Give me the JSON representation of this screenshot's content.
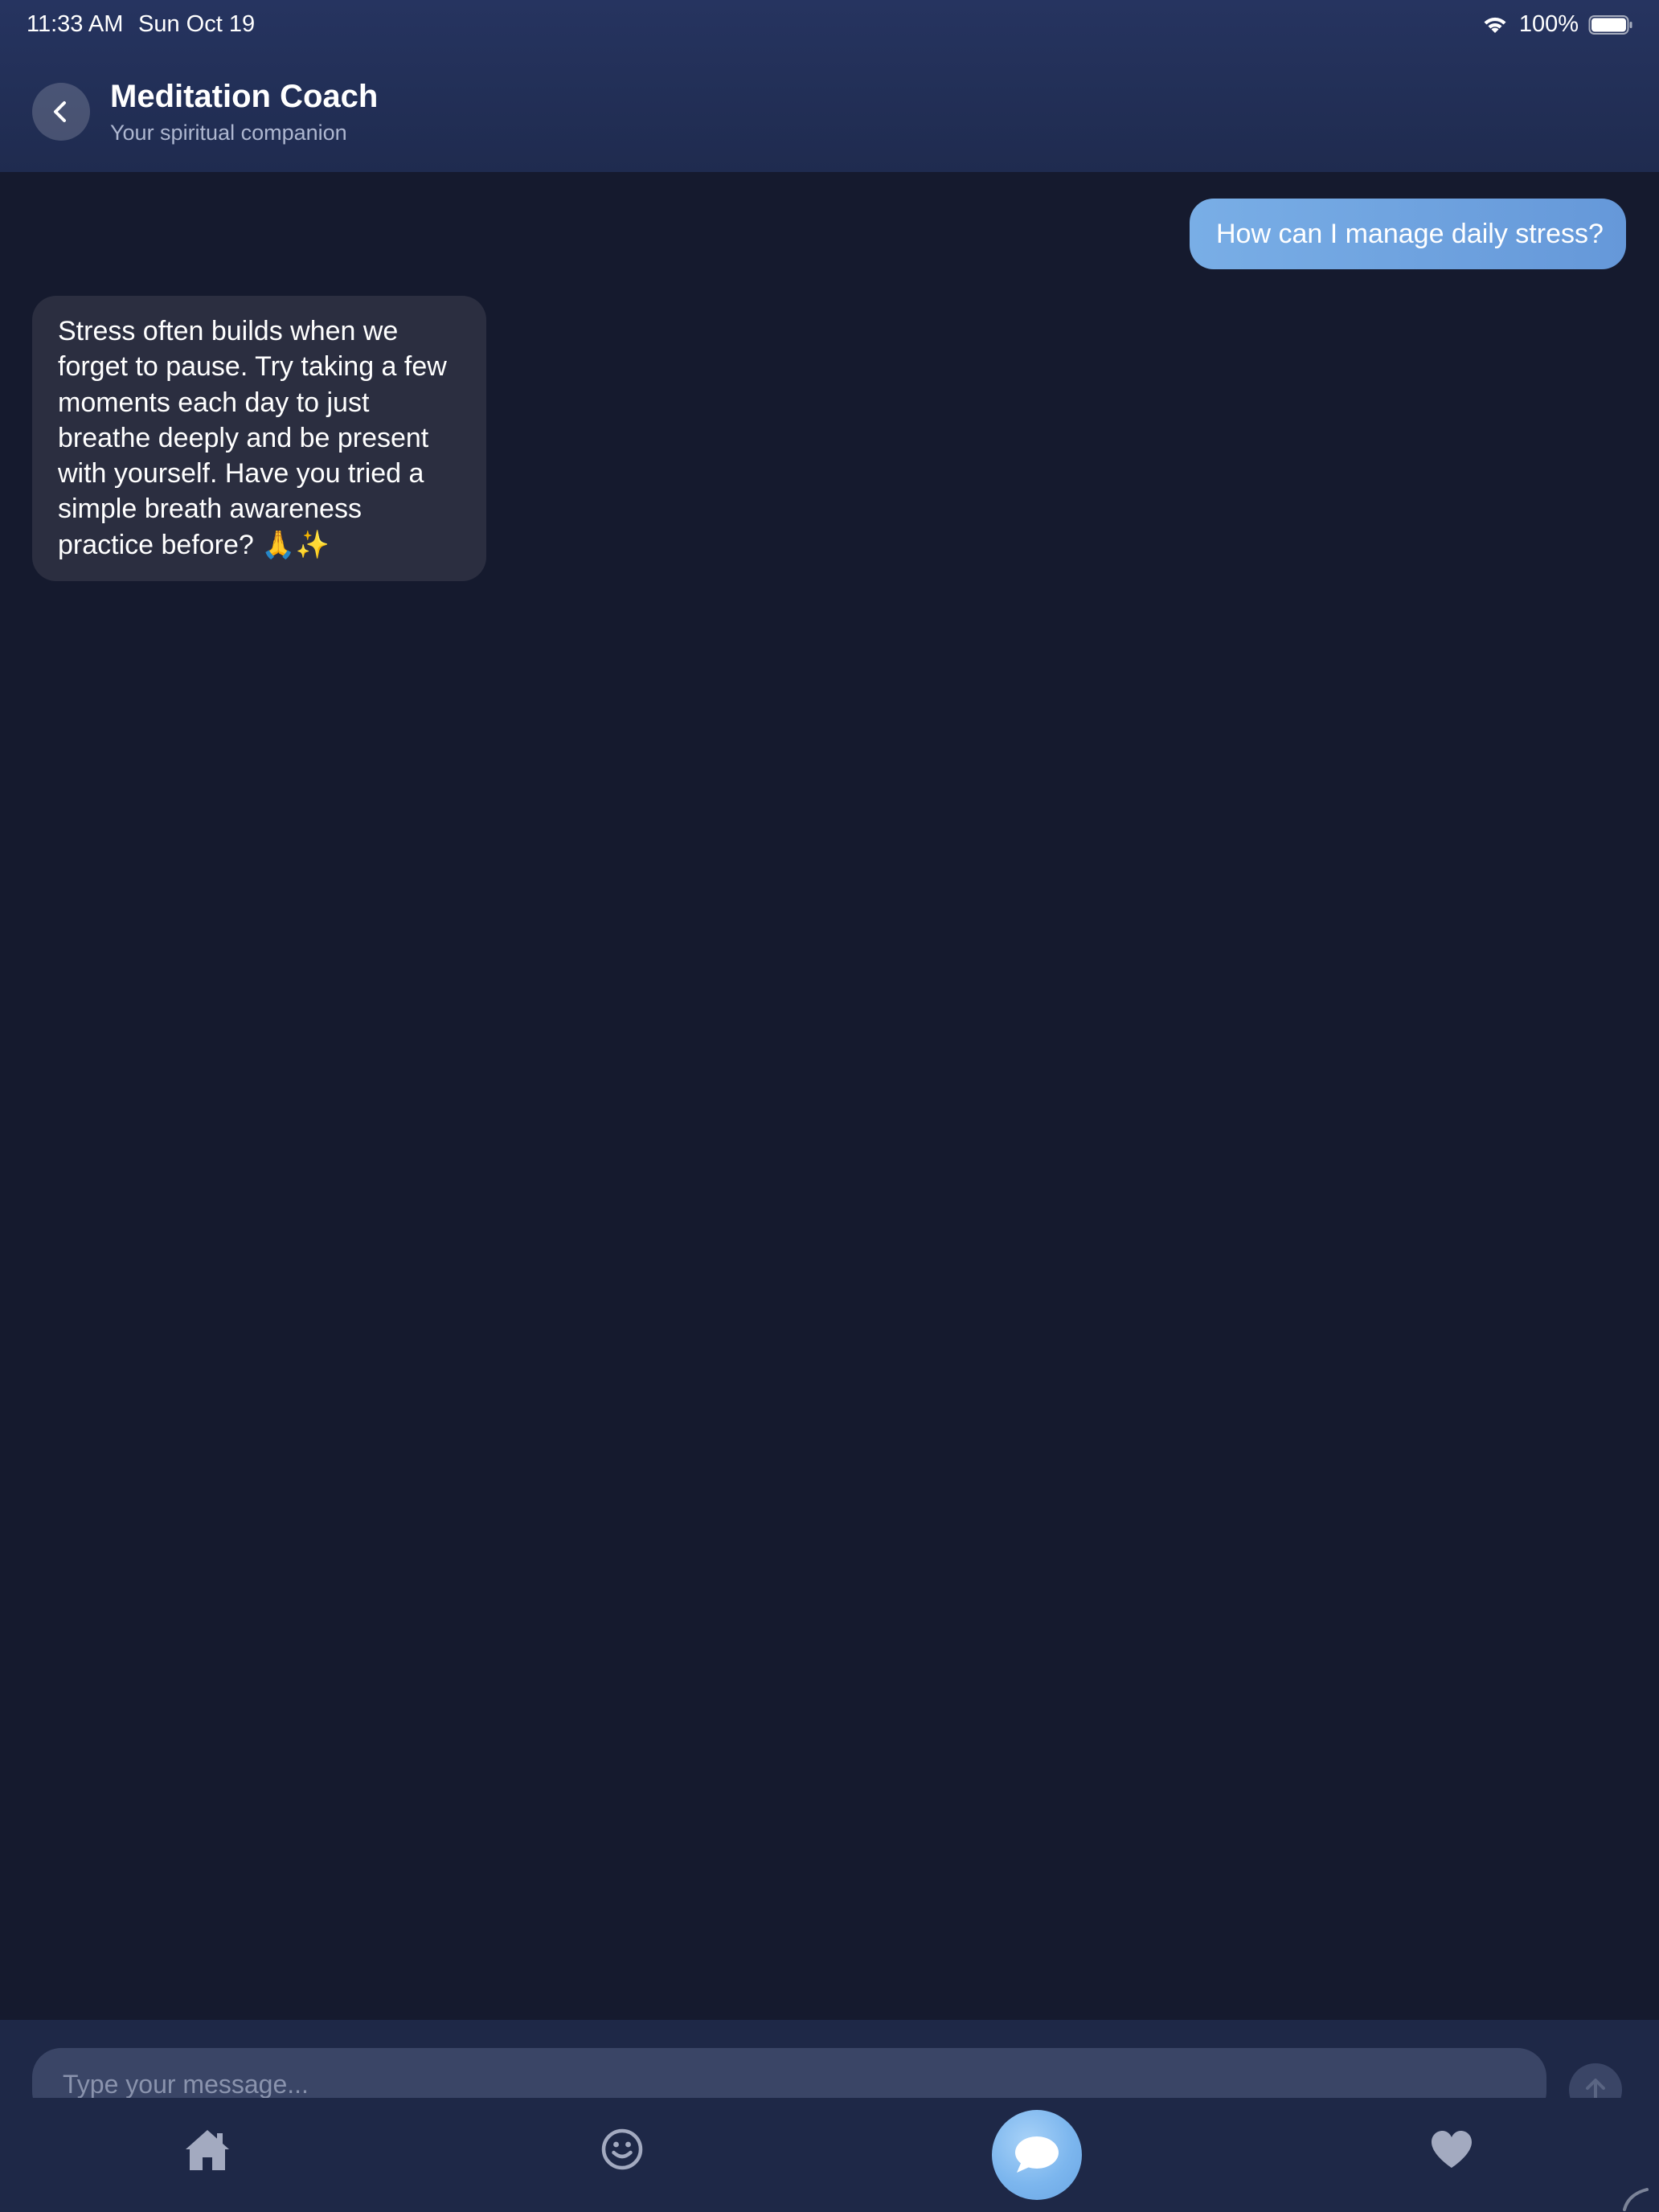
{
  "status_bar": {
    "time": "11:33 AM",
    "date": "Sun Oct 19",
    "battery": "100%",
    "icons": [
      "wifi-icon",
      "battery-icon"
    ]
  },
  "header": {
    "title": "Meditation Coach",
    "subtitle": "Your spiritual companion",
    "back_icon": "chevron-left-icon"
  },
  "conversation": {
    "messages": [
      {
        "sender": "user",
        "text": "How can I manage daily stress?"
      },
      {
        "sender": "coach",
        "lines": [
          "Stress often builds when we",
          "forget to pause. Try taking a few",
          "moments each day to just",
          "breathe deeply and be present",
          "with yourself. Have you tried a",
          "simple breath awareness",
          "practice before? 🙏✨"
        ]
      }
    ]
  },
  "composer": {
    "placeholder": "Type your message...",
    "value": "",
    "send_icon": "arrow-up-icon"
  },
  "tab_bar": {
    "tabs": [
      {
        "id": "home",
        "icon": "home-icon",
        "active": false
      },
      {
        "id": "mood",
        "icon": "smiley-icon",
        "active": false
      },
      {
        "id": "chat",
        "icon": "chat-bubble-icon",
        "active": true
      },
      {
        "id": "favorites",
        "icon": "heart-icon",
        "active": false
      }
    ]
  },
  "colors": {
    "background": "#151a2e",
    "header": "#263460",
    "user_bubble": "#6fa3df",
    "coach_bubble": "#2b2e40",
    "tab_bar": "#1e2847",
    "active_tab": "#7cb6ee",
    "inactive_icon": "#a3aac0"
  }
}
